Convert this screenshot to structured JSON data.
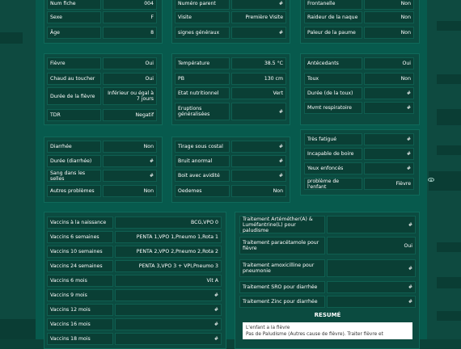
{
  "identity": {
    "num_fiche": {
      "label": "Num fiche",
      "value": "004"
    },
    "sexe": {
      "label": "Sexe",
      "value": "F"
    },
    "age": {
      "label": "Âge",
      "value": "8"
    }
  },
  "visit": {
    "numero_parent": {
      "label": "Numéro parent",
      "value": "#"
    },
    "visite": {
      "label": "Visite",
      "value": "Première Visite"
    },
    "signes_generaux": {
      "label": "signes généraux",
      "value": "#"
    }
  },
  "head": {
    "frontanelle": {
      "label": "Frontanelle",
      "value": "Non"
    },
    "raideur_nuque": {
      "label": "Raideur de la naque",
      "value": "Non"
    },
    "paleur_paume": {
      "label": "Paleur de la paume",
      "value": "Non"
    }
  },
  "fever": {
    "fievre": {
      "label": "Fièvre",
      "value": "Oui"
    },
    "chaud": {
      "label": "Chaud au toucher",
      "value": "Oui"
    },
    "duree_fievre": {
      "label": "Durée de la fièvre",
      "value": "Inférieur ou égal à 7 jours"
    },
    "tdr": {
      "label": "TDR",
      "value": "Negatif"
    }
  },
  "vitals": {
    "temperature": {
      "label": "Température",
      "value": "38.5 °C"
    },
    "pb": {
      "label": "PB",
      "value": "130 cm"
    },
    "etat_nutritionnel": {
      "label": "Etat nutritionnel",
      "value": "Vert"
    },
    "eruptions": {
      "label": "Eruptions généralisées",
      "value": "#"
    }
  },
  "history": {
    "antecedants": {
      "label": "Antécedants",
      "value": "Oui"
    },
    "toux": {
      "label": "Toux",
      "value": "Non"
    },
    "duree_toux": {
      "label": "Durée (de la toux)",
      "value": "#"
    },
    "mvmt_respiratoire": {
      "label": "Mvmt respiratoire",
      "value": "#"
    }
  },
  "diarrhea": {
    "diarrhee": {
      "label": "Diarrhée",
      "value": "Non"
    },
    "duree_diarrhee": {
      "label": "Durée (diarrhée)",
      "value": "#"
    },
    "sang_selles": {
      "label": "Sang dans les selles",
      "value": "#"
    },
    "autres_problemes": {
      "label": "Autres problèmes",
      "value": "Non"
    }
  },
  "breathing": {
    "tirage": {
      "label": "Tirage sous costal",
      "value": "#"
    },
    "bruit_anormal": {
      "label": "Bruit anormal",
      "value": "#"
    },
    "boit_avidite": {
      "label": "Boit avec avidité",
      "value": "#"
    },
    "oedemes": {
      "label": "Oedemes",
      "value": "Non"
    }
  },
  "danger": {
    "tres_fatigue": {
      "label": "Très fatigué",
      "value": "#"
    },
    "incapable_boire": {
      "label": "Incapable de boire",
      "value": "#"
    },
    "yeux_enfonces": {
      "label": "Yeux enfoncés",
      "value": "#"
    },
    "probleme_enfant": {
      "label": "problème de l'enfant",
      "value": "Fièvre"
    }
  },
  "vaccines": [
    {
      "label": "Vaccins à la naissance",
      "value": "BCG,VPO 0"
    },
    {
      "label": "Vaccins 6 semaines",
      "value": "PENTA 1,VPO 1,Pneumo 1,Rota 1"
    },
    {
      "label": "Vaccins 10 semaines",
      "value": "PENTA 2,VPO 2,Pneumo 2,Rota 2"
    },
    {
      "label": "Vaccins 24 semaines",
      "value": "PENTA 3,VPO 3 + VPI,Pneumo 3"
    },
    {
      "label": "Vaccins 6 mois",
      "value": "Vit A"
    },
    {
      "label": "Vaccins 9 mois",
      "value": "#"
    },
    {
      "label": "Vaccins 12 mois",
      "value": "#"
    },
    {
      "label": "Vaccins 16 mois",
      "value": "#"
    },
    {
      "label": "Vaccins 18 mois",
      "value": "#"
    }
  ],
  "treatments": [
    {
      "label": "Traitement Artéméther(A) & Luméfantrine(L) pour paludisme",
      "value": "#"
    },
    {
      "label": "Traitement paracétamole pour fièvre",
      "value": "Oui"
    },
    {
      "label": "Traitement amoxicilline pour pneumonie",
      "value": "#"
    },
    {
      "label": "Traitement SRO pour diarrhée",
      "value": "#"
    },
    {
      "label": "Traitement Zinc pour diarrhée",
      "value": "#"
    }
  ],
  "resume": {
    "title": "RESUMÉ",
    "line1": "L'enfant a la fièvre",
    "line2": "Pas de Paludisme (Autres cause de fièvre). Traiter fièvre et"
  },
  "colors": {
    "accent": "#075a4d",
    "field": "#0a3f35",
    "card": "#0b4b40"
  }
}
